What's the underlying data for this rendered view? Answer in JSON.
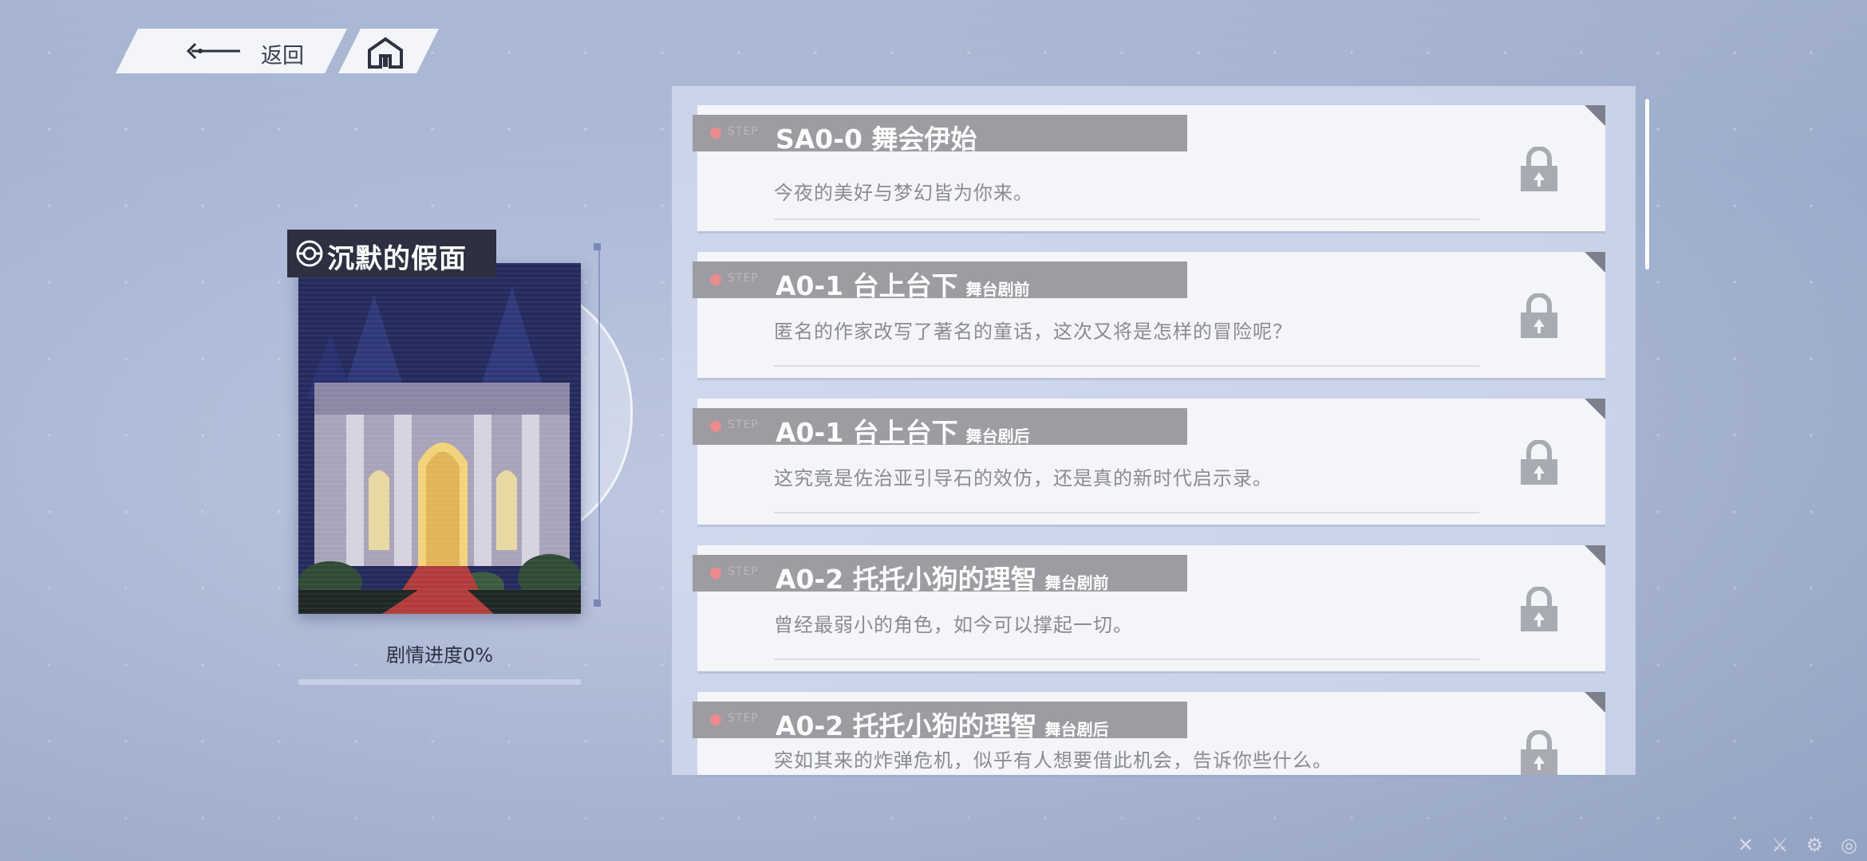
{
  "nav": {
    "back_label": "返回",
    "back_icon": "back-arrow-icon",
    "home_icon": "home-icon"
  },
  "chapter": {
    "title": "沉默的假面",
    "icon": "masquerade-icon",
    "progress_label": "剧情进度0%",
    "progress_value": 0
  },
  "stories": [
    {
      "code": "SA0-0 舞会伊始",
      "tag": "",
      "description": "今夜的美好与梦幻皆为你来。",
      "locked": true
    },
    {
      "code": "A0-1 台上台下",
      "tag": "舞台剧前",
      "description": "匿名的作家改写了著名的童话，这次又将是怎样的冒险呢？",
      "locked": true
    },
    {
      "code": "A0-1 台上台下",
      "tag": "舞台剧后",
      "description": "这究竟是佐治亚引导石的效仿，还是真的新时代启示录。",
      "locked": true
    },
    {
      "code": "A0-2 托托小狗的理智",
      "tag": "舞台剧前",
      "description": "曾经最弱小的角色，如今可以撑起一切。",
      "locked": true
    },
    {
      "code": "A0-2 托托小狗的理智",
      "tag": "舞台剧后",
      "description": "突如其来的炸弹危机，似乎有人想要借此机会，告诉你些什么。",
      "locked": true
    }
  ],
  "colors": {
    "accent": "#6d7ab0",
    "title_bar": "#9c9ca2",
    "dot": "#ef8a8d"
  }
}
